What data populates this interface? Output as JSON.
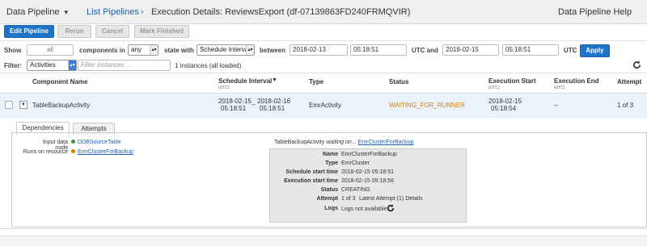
{
  "topbar": {
    "app": "Data Pipeline",
    "app_caret": "▾",
    "list_link": "List Pipelines",
    "sep": "›",
    "execution_title": "Execution Details: ReviewsExport (df-07139863FD240FRMQVIR)",
    "help": "Data Pipeline Help"
  },
  "toolbar": {
    "edit": "Edit Pipeline",
    "rerun": "Rerun",
    "cancel": "Cancel",
    "mark_finished": "Mark Finished"
  },
  "filter_row": {
    "show_label": "Show",
    "show_value": "all",
    "components_in_label": "components in",
    "state_select": "any",
    "state_with_label": "state with",
    "interval_select": "Schedule Interval",
    "between_label": "between",
    "from_date": "2018-02-13",
    "from_time": "05:18:51",
    "utc_and_label": "UTC and",
    "to_date": "2018-02-15",
    "to_time": "05:18:51",
    "utc_label": "UTC",
    "apply": "Apply"
  },
  "filter2": {
    "label": "Filter:",
    "select": "Activities",
    "placeholder": "Filter instances ...",
    "count": "1 instances (all loaded)"
  },
  "table": {
    "headers": {
      "component": "Component Name",
      "schedule": "Schedule Interval",
      "schedule_sub": "(UTC)",
      "type": "Type",
      "status": "Status",
      "exec_start": "Execution Start",
      "exec_start_sub": "(UTC)",
      "exec_end": "Execution End",
      "exec_end_sub": "(UTC)",
      "attempt": "Attempt"
    },
    "row": {
      "name": "TableBackupActivity",
      "sched_from_date": "2018-02-15",
      "sched_from_time": "05:18:51",
      "sched_dash": "–",
      "sched_to_date": "2018-02-16",
      "sched_to_time": "05:18:51",
      "type": "EmrActivity",
      "status": "WAITING_FOR_RUNNER",
      "exec_start_date": "2018-02-15",
      "exec_start_time": "05:18:54",
      "exec_end": "–",
      "attempt": "1 of 3"
    }
  },
  "detail": {
    "tab_dependencies": "Dependencies",
    "tab_attempts": "Attempts",
    "input_label": "Input data node",
    "input_value": "DDBSourceTable",
    "runs_on_label": "Runs on resource",
    "runs_on_value": "EmrClusterForBackup",
    "waiting_prefix": "TableBackupActivity",
    "waiting_mid": "waiting on...",
    "waiting_link": "EmrClusterForBackup",
    "attempt_box": {
      "name_k": "Name",
      "name_v": "EmrClusterForBackup",
      "type_k": "Type",
      "type_v": "EmrCluster",
      "sched_k": "Schedule start time",
      "sched_v": "2018-02-15 05:18:51",
      "exec_k": "Execution start time",
      "exec_v": "2018-02-15 05:18:56",
      "status_k": "Status",
      "status_v": "CREATING",
      "attempt_k": "Attempt",
      "attempt_v": "1 of 3",
      "attempt_link": "Latest Attempt (1) Details",
      "logs_k": "Logs",
      "logs_v": "Logs not available"
    }
  },
  "colors": {
    "accent": "#1e74c9",
    "status_waiting": "#e07b00",
    "dot_green": "#3a9b3a",
    "dot_orange": "#e07b00"
  }
}
